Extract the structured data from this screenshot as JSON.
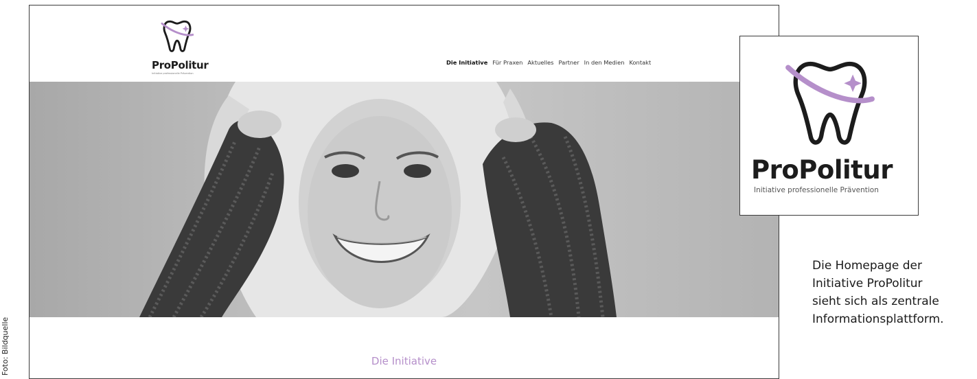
{
  "credit": "Foto: Bildquelle",
  "site": {
    "logo": {
      "wordmark": "ProPolitur",
      "tagline": "Initiative professionelle Prävention"
    },
    "nav": [
      {
        "label": "Die Initiative",
        "active": true
      },
      {
        "label": "Für Praxen",
        "active": false
      },
      {
        "label": "Aktuelles",
        "active": false
      },
      {
        "label": "Partner",
        "active": false
      },
      {
        "label": "In den Medien",
        "active": false
      },
      {
        "label": "Kontakt",
        "active": false
      }
    ],
    "section_heading": "Die Initiative"
  },
  "logo_card": {
    "wordmark": "ProPolitur",
    "tagline": "Initiative professionelle Prävention"
  },
  "caption": [
    "Die Homepage der",
    "Initiative ProPolitur",
    "sieht sich als zentrale",
    "Informationsplattform."
  ],
  "colors": {
    "accent": "#b58fca",
    "text": "#1c1c1c"
  },
  "icons": {
    "brand": "tooth-logo-icon",
    "hero": "smiling-woman-photo"
  }
}
